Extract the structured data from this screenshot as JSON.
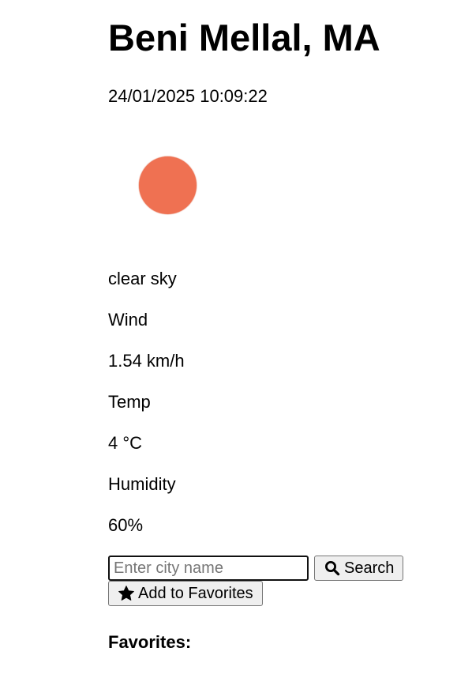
{
  "weather": {
    "city": "Beni Mellal, MA",
    "datetime": "24/01/2025 10:09:22",
    "icon": "sun-icon",
    "icon_color": "#ef7152",
    "description": "clear sky",
    "wind_label": "Wind",
    "wind_value": "1.54 km/h",
    "temp_label": "Temp",
    "temp_value": "4 °C",
    "humidity_label": "Humidity",
    "humidity_value": "60%"
  },
  "search": {
    "placeholder": "Enter city name",
    "value": "",
    "button_label": "Search",
    "button_icon": "search-icon"
  },
  "favorites": {
    "add_button_label": "Add to Favorites",
    "add_button_icon": "star-icon",
    "heading": "Favorites:",
    "items": []
  }
}
